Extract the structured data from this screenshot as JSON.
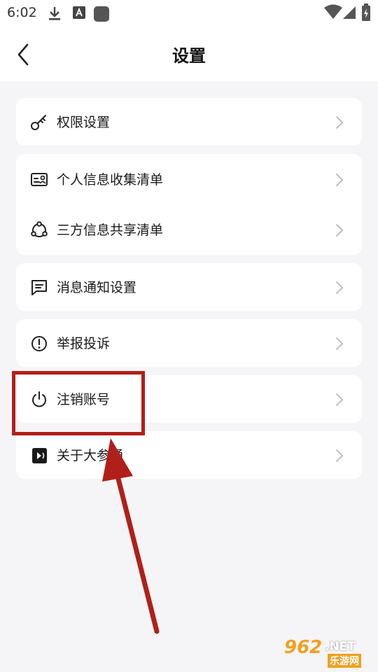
{
  "status_bar": {
    "time": "6:02"
  },
  "header": {
    "title": "设置"
  },
  "groups": [
    {
      "items": [
        {
          "label": "权限设置",
          "icon": "key-icon"
        }
      ]
    },
    {
      "items": [
        {
          "label": "个人信息收集清单",
          "icon": "id-card-icon"
        },
        {
          "label": "三方信息共享清单",
          "icon": "share-nodes-icon"
        }
      ]
    },
    {
      "items": [
        {
          "label": "消息通知设置",
          "icon": "message-icon"
        }
      ]
    },
    {
      "items": [
        {
          "label": "举报投诉",
          "icon": "alert-circle-icon"
        }
      ]
    },
    {
      "items": [
        {
          "label": "注销账号",
          "icon": "power-icon"
        }
      ]
    },
    {
      "items": [
        {
          "label": "关于大参通",
          "icon": "app-logo-icon"
        }
      ]
    }
  ],
  "watermark": {
    "number": "962",
    "suffix": ".NET",
    "subtitle": "乐游网"
  },
  "colors": {
    "background": "#f5f5f7",
    "card": "#ffffff",
    "annotation_red": "#b11f1a",
    "chevron": "#b8b8b8"
  }
}
